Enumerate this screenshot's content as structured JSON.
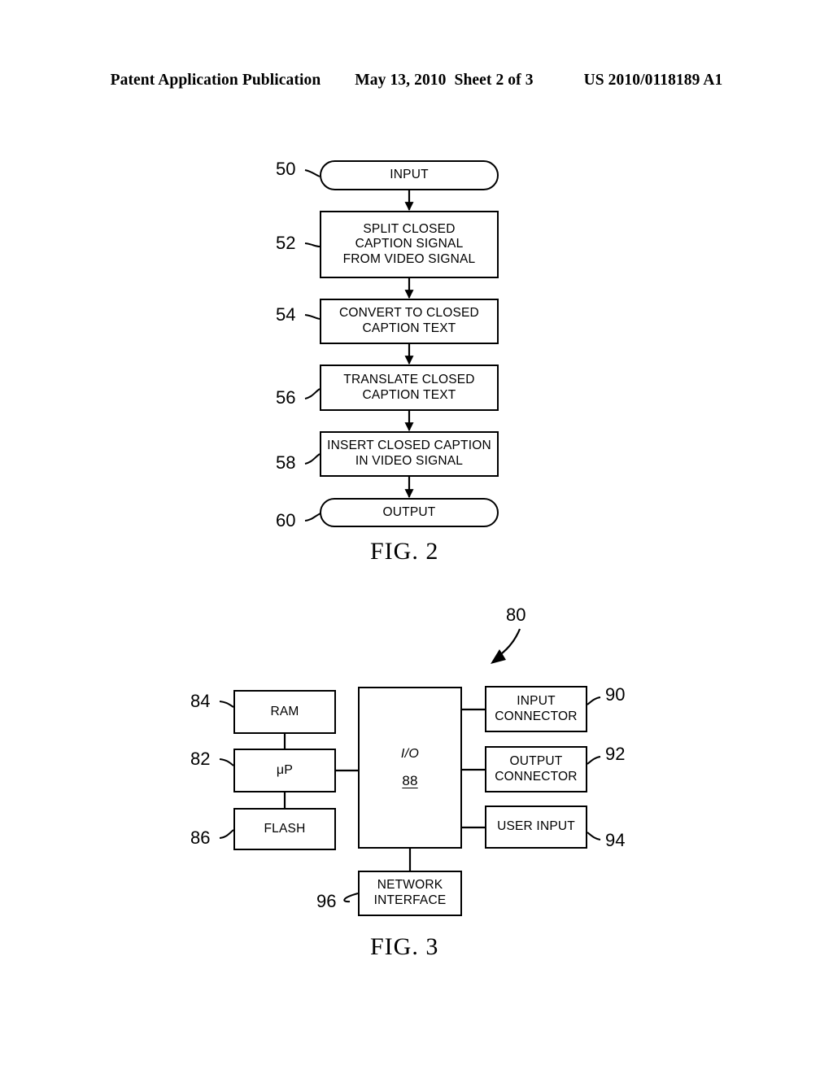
{
  "header": {
    "publication": "Patent Application Publication",
    "date": "May 13, 2010",
    "sheet": "Sheet 2 of 3",
    "patent_number": "US 2010/0118189 A1"
  },
  "figure2": {
    "caption": "FIG. 2",
    "nodes": [
      {
        "ref": "50",
        "shape": "stadium",
        "lines": [
          "INPUT"
        ]
      },
      {
        "ref": "52",
        "shape": "rect",
        "lines": [
          "SPLIT CLOSED",
          "CAPTION SIGNAL",
          "FROM VIDEO SIGNAL"
        ]
      },
      {
        "ref": "54",
        "shape": "rect",
        "lines": [
          "CONVERT TO CLOSED",
          "CAPTION TEXT"
        ]
      },
      {
        "ref": "56",
        "shape": "rect",
        "lines": [
          "TRANSLATE CLOSED",
          "CAPTION TEXT"
        ]
      },
      {
        "ref": "58",
        "shape": "rect",
        "lines": [
          "INSERT CLOSED CAPTION",
          "IN VIDEO SIGNAL"
        ]
      },
      {
        "ref": "60",
        "shape": "stadium",
        "lines": [
          "OUTPUT"
        ]
      }
    ]
  },
  "figure3": {
    "caption": "FIG. 3",
    "system_ref": "80",
    "nodes": [
      {
        "ref": "84",
        "lines": [
          "RAM"
        ]
      },
      {
        "ref": "82",
        "lines": [
          "μP"
        ]
      },
      {
        "ref": "86",
        "lines": [
          "FLASH"
        ]
      },
      {
        "ref": "88",
        "lines": [
          "I/O"
        ],
        "num_inside": "88"
      },
      {
        "ref": "90",
        "lines": [
          "INPUT",
          "CONNECTOR"
        ]
      },
      {
        "ref": "92",
        "lines": [
          "OUTPUT",
          "CONNECTOR"
        ]
      },
      {
        "ref": "94",
        "lines": [
          "USER INPUT"
        ]
      },
      {
        "ref": "96",
        "lines": [
          "NETWORK",
          "INTERFACE"
        ]
      }
    ]
  }
}
